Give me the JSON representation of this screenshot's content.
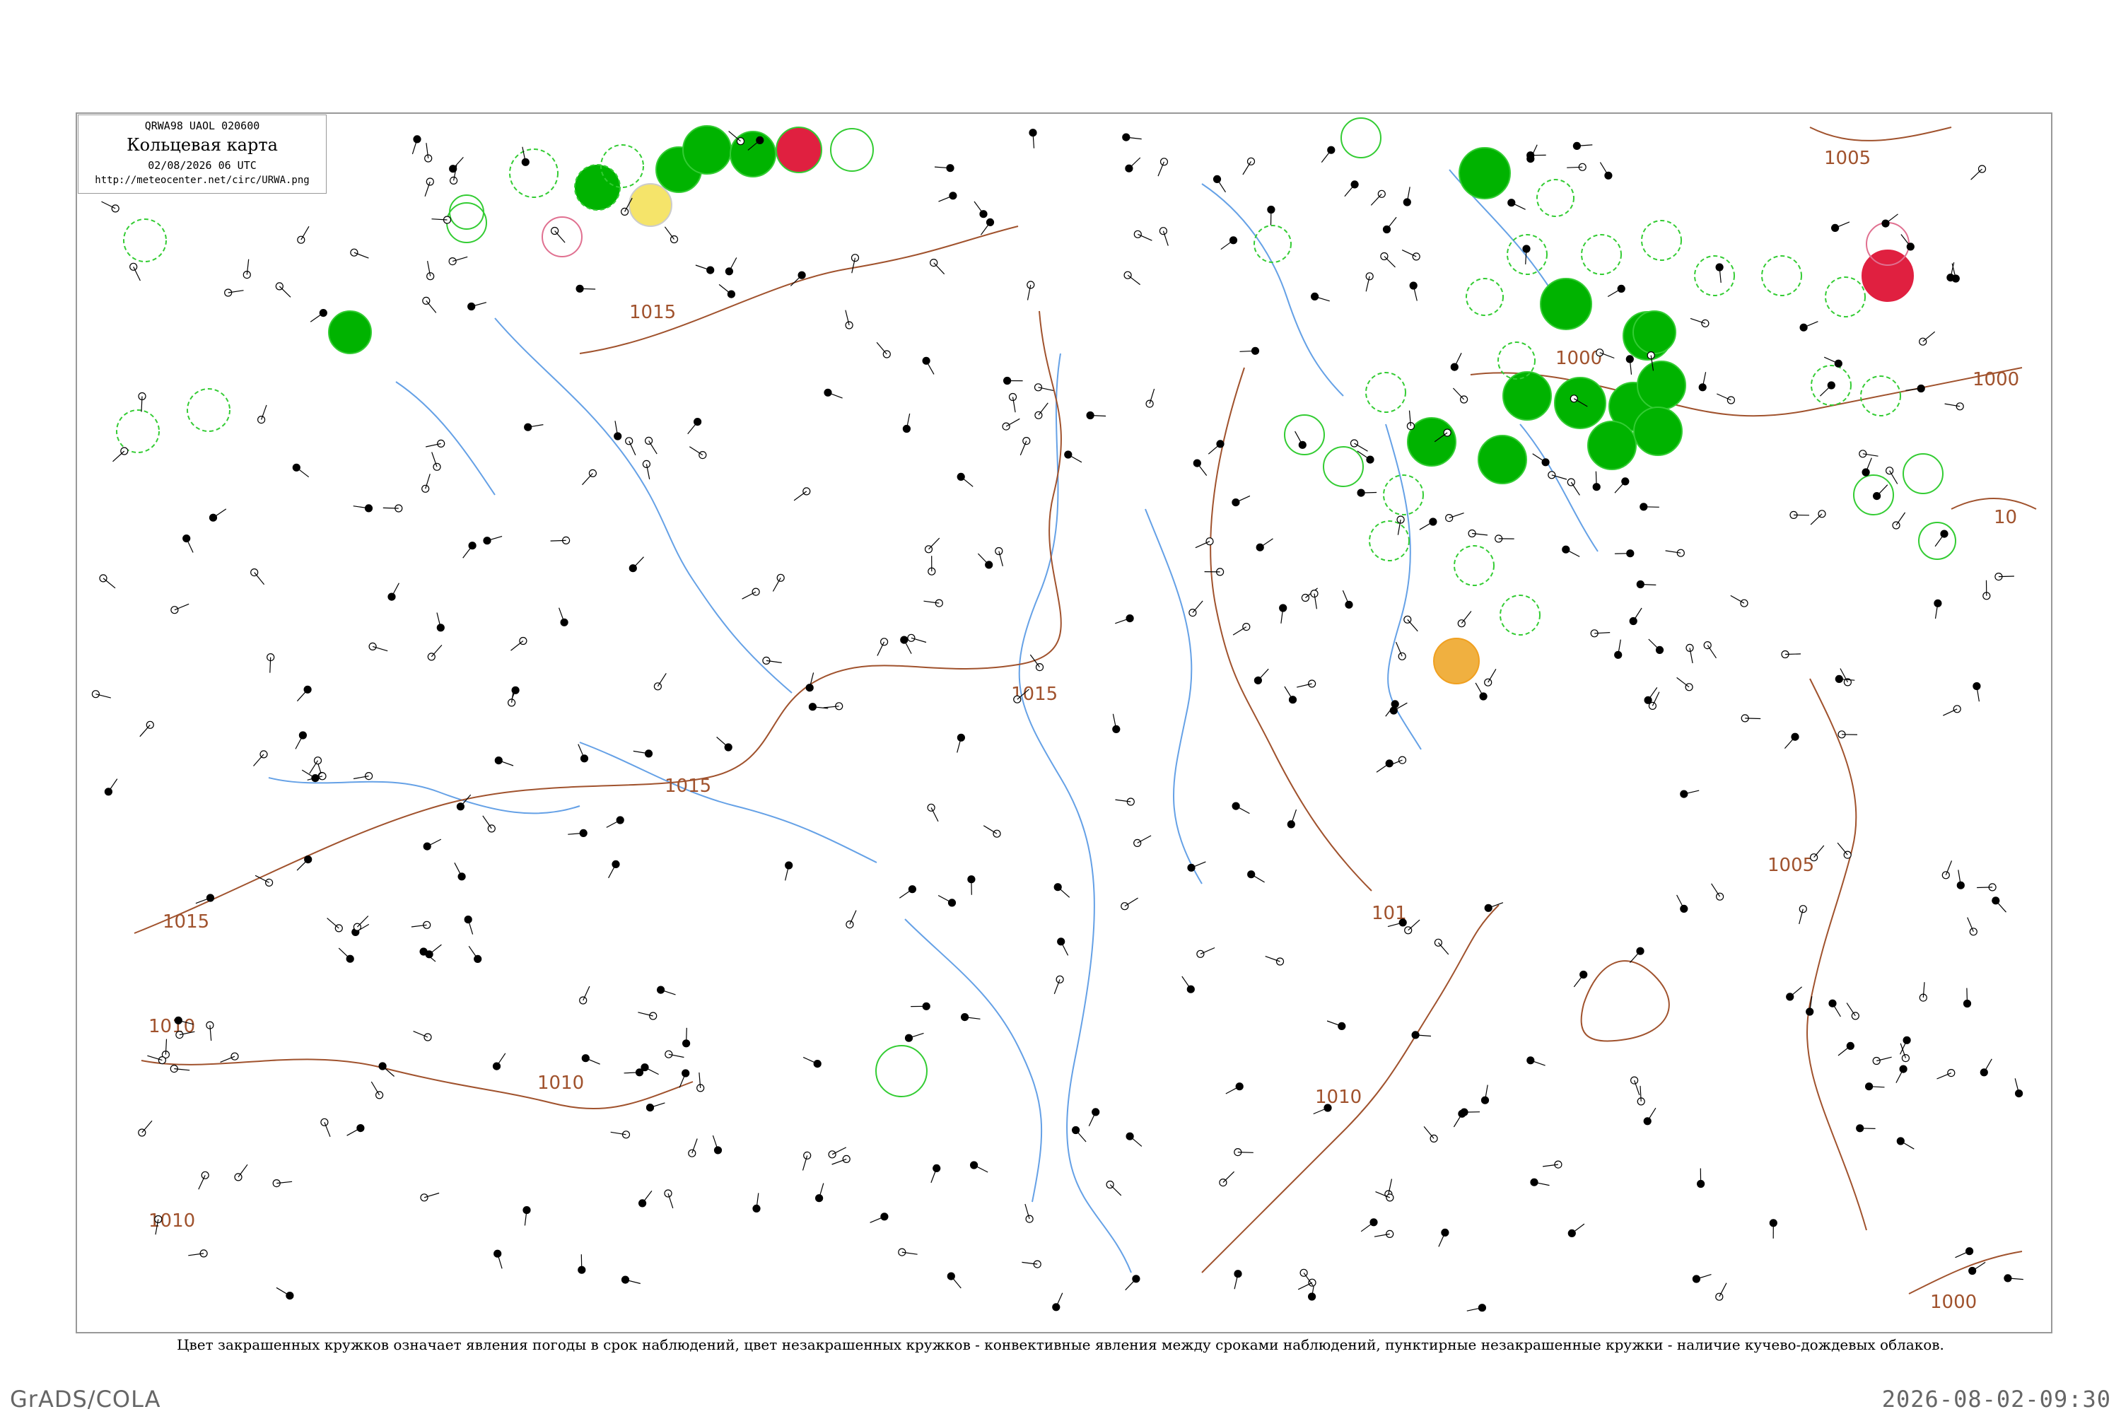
{
  "header": {
    "code": "QRWA98  UAOL  020600",
    "title": "Кольцевая карта",
    "datetime": "02/08/2026 06 UTC",
    "url": "http://meteocenter.net/circ/URWA.png"
  },
  "caption": "Цвет закрашенных кружков означает явления погоды в срок наблюдений, цвет незакрашенных кружков - конвективные явления между сроками наблюдений, пунктирные незакрашенные кружки - наличие кучево-дождевых облаков.",
  "footer": {
    "left": "GrADS/COLA",
    "right": "2026-08-02-09:30"
  },
  "isobars": {
    "labels": [
      "1015",
      "1015",
      "1015",
      "1015",
      "1015",
      "1010",
      "1010",
      "1010",
      "1010",
      "1005",
      "1005",
      "1000",
      "1000",
      "1000",
      "1000",
      "10",
      "101"
    ]
  },
  "colors": {
    "frame": "#999999",
    "isobar": "#a0522d",
    "river": "#4a90e2",
    "rain": "#00b300",
    "thunder": "#e02040",
    "fog": "#f5d200",
    "dust": "#f0a020",
    "dashed_cb": "#33cc33"
  }
}
